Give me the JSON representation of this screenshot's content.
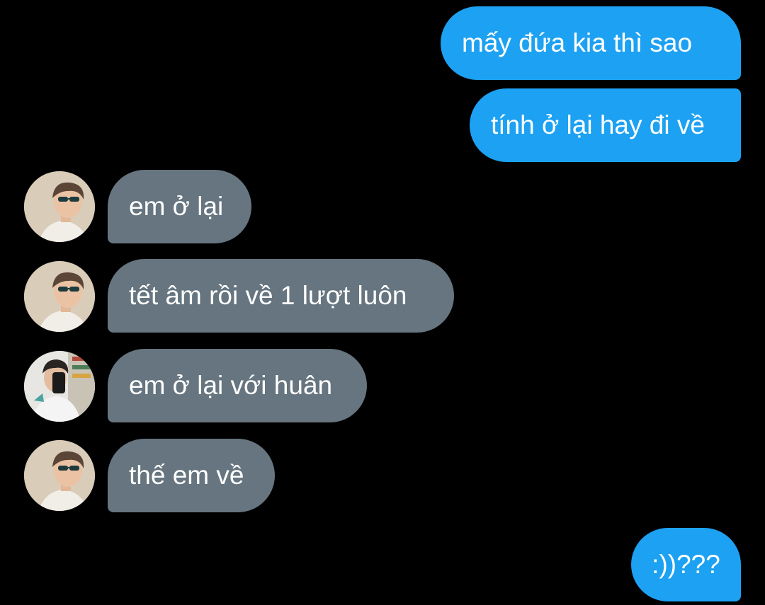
{
  "messages": [
    {
      "id": "m1",
      "direction": "outgoing",
      "text": "mấy đứa kia thì sao"
    },
    {
      "id": "m2",
      "direction": "outgoing",
      "text": "tính ở lại hay đi về"
    },
    {
      "id": "m3",
      "direction": "incoming",
      "text": "em ở lại",
      "avatar": "sunglasses-boy-avatar"
    },
    {
      "id": "m4",
      "direction": "incoming",
      "text": "tết âm rồi về 1 lượt luôn",
      "avatar": "sunglasses-boy-avatar"
    },
    {
      "id": "m5",
      "direction": "incoming",
      "text": "em ở lại với huân",
      "avatar": "mirror-selfie-avatar"
    },
    {
      "id": "m6",
      "direction": "incoming",
      "text": "thế em về",
      "avatar": "sunglasses-boy-avatar"
    },
    {
      "id": "m7",
      "direction": "outgoing",
      "text": ":))???"
    }
  ],
  "colors": {
    "background": "#000000",
    "outgoing_bubble": "#1da1f2",
    "incoming_bubble": "#66757f",
    "text": "#ffffff"
  }
}
